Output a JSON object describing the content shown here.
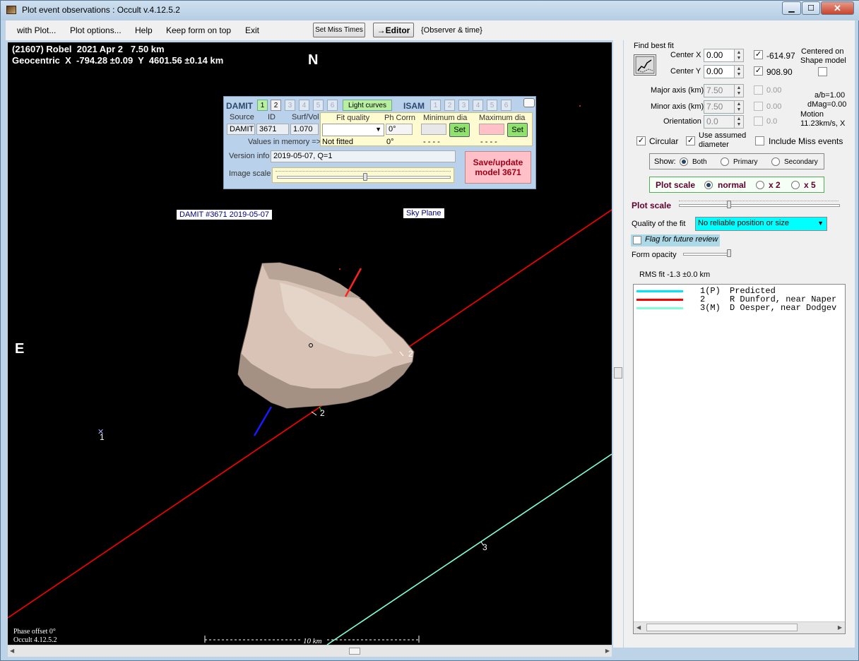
{
  "window": {
    "title": "Plot event observations : Occult v.4.12.5.2",
    "minimize": "▁",
    "maximize": "☐",
    "close": "✕"
  },
  "menu": {
    "with_plot": "with Plot...",
    "plot_options": "Plot options...",
    "help": "Help",
    "keep_on_top": "Keep form on top",
    "exit": "Exit",
    "set_miss_times": "Set Miss Times",
    "editor": "→Editor",
    "observer_time": "{Observer & time}"
  },
  "plot": {
    "header_line1": "(21607) Robel  2021 Apr 2   7.50 km",
    "header_line2": "Geocentric  X  -794.28 ±0.09  Y  4601.56 ±0.14 km",
    "north": "N",
    "east": "E",
    "damit_label": "DAMIT #3671 2019-05-07",
    "sky_plane_label": "Sky Plane",
    "chord1": "1",
    "chord2a": "2",
    "chord2b": "2",
    "chord3": "3",
    "phase_offset": "Phase offset 0°",
    "occult_version": "Occult 4.12.5.2",
    "scale_label": "10 km"
  },
  "damit_panel": {
    "damit": "DAMIT",
    "model_buttons": [
      "1",
      "2",
      "3",
      "4",
      "5",
      "6"
    ],
    "light_curves": "Light curves",
    "isam": "ISAM",
    "isam_buttons": [
      "1",
      "2",
      "3",
      "4",
      "5",
      "6"
    ],
    "col_source": "Source",
    "col_id": "ID",
    "col_surfvol": "Surf/Vol",
    "source_value": "DAMIT",
    "id_value": "3671",
    "surfvol_value": "1.070",
    "values_in_memory": "Values in memory =>",
    "fit_quality": "Fit quality",
    "ph_corrn": "Ph Corrn",
    "min_dia": "Minimum dia",
    "max_dia": "Maximum dia",
    "ph_value": "0°",
    "set": "Set",
    "not_fitted": "Not fitted",
    "ph_memory": "0°",
    "min_memory": "- - - -",
    "max_memory": "- - - -",
    "version_info": "Version info",
    "version_value": "2019-05-07, Q=1",
    "image_scale": "Image scale",
    "save_line1": "Save/update",
    "save_line2": "model 3671"
  },
  "side": {
    "find_best_fit": "Find best fit",
    "center_x": "Center X",
    "center_x_value": "0.00",
    "center_x_fixed": "-614.97",
    "center_y": "Center Y",
    "center_y_value": "0.00",
    "center_y_fixed": "908.90",
    "centered_on": "Centered on",
    "shape_model": "Shape model",
    "major_axis": "Major axis (km)",
    "major_value": "7.50",
    "major_fixed": "0.00",
    "minor_axis": "Minor axis (km)",
    "minor_value": "7.50",
    "minor_fixed": "0.00",
    "orientation": "Orientation",
    "orientation_value": "0.0",
    "orientation_fixed": "0.0",
    "ab_ratio": "a/b=1.00",
    "dmag": "dMag=0.00",
    "motion": "Motion",
    "motion_value": "11.23km/s, X",
    "circular": "Circular",
    "use_assumed_1": "Use assumed",
    "use_assumed_2": "diameter",
    "include_miss": "Include Miss events",
    "show": "Show:",
    "both": "Both",
    "primary": "Primary",
    "secondary": "Secondary",
    "plot_scale_group": "Plot scale",
    "normal": "normal",
    "x2": "x 2",
    "x5": "x 5",
    "plot_scale": "Plot scale",
    "quality_label": "Quality of the fit",
    "quality_value": "No reliable position or size",
    "flag_review": "Flag for future review",
    "form_opacity": "Form opacity",
    "rms_fit": "RMS fit  -1.3 ±0.0 km"
  },
  "legend": [
    {
      "id": "1(P)",
      "text": "Predicted",
      "color": "#00e5ff"
    },
    {
      "id": "2   ",
      "text": "R Dunford, near Naper",
      "color": "#ff0000"
    },
    {
      "id": "3(M)",
      "text": "D Oesper, near Dodgev",
      "color": "#7fffd4"
    }
  ]
}
